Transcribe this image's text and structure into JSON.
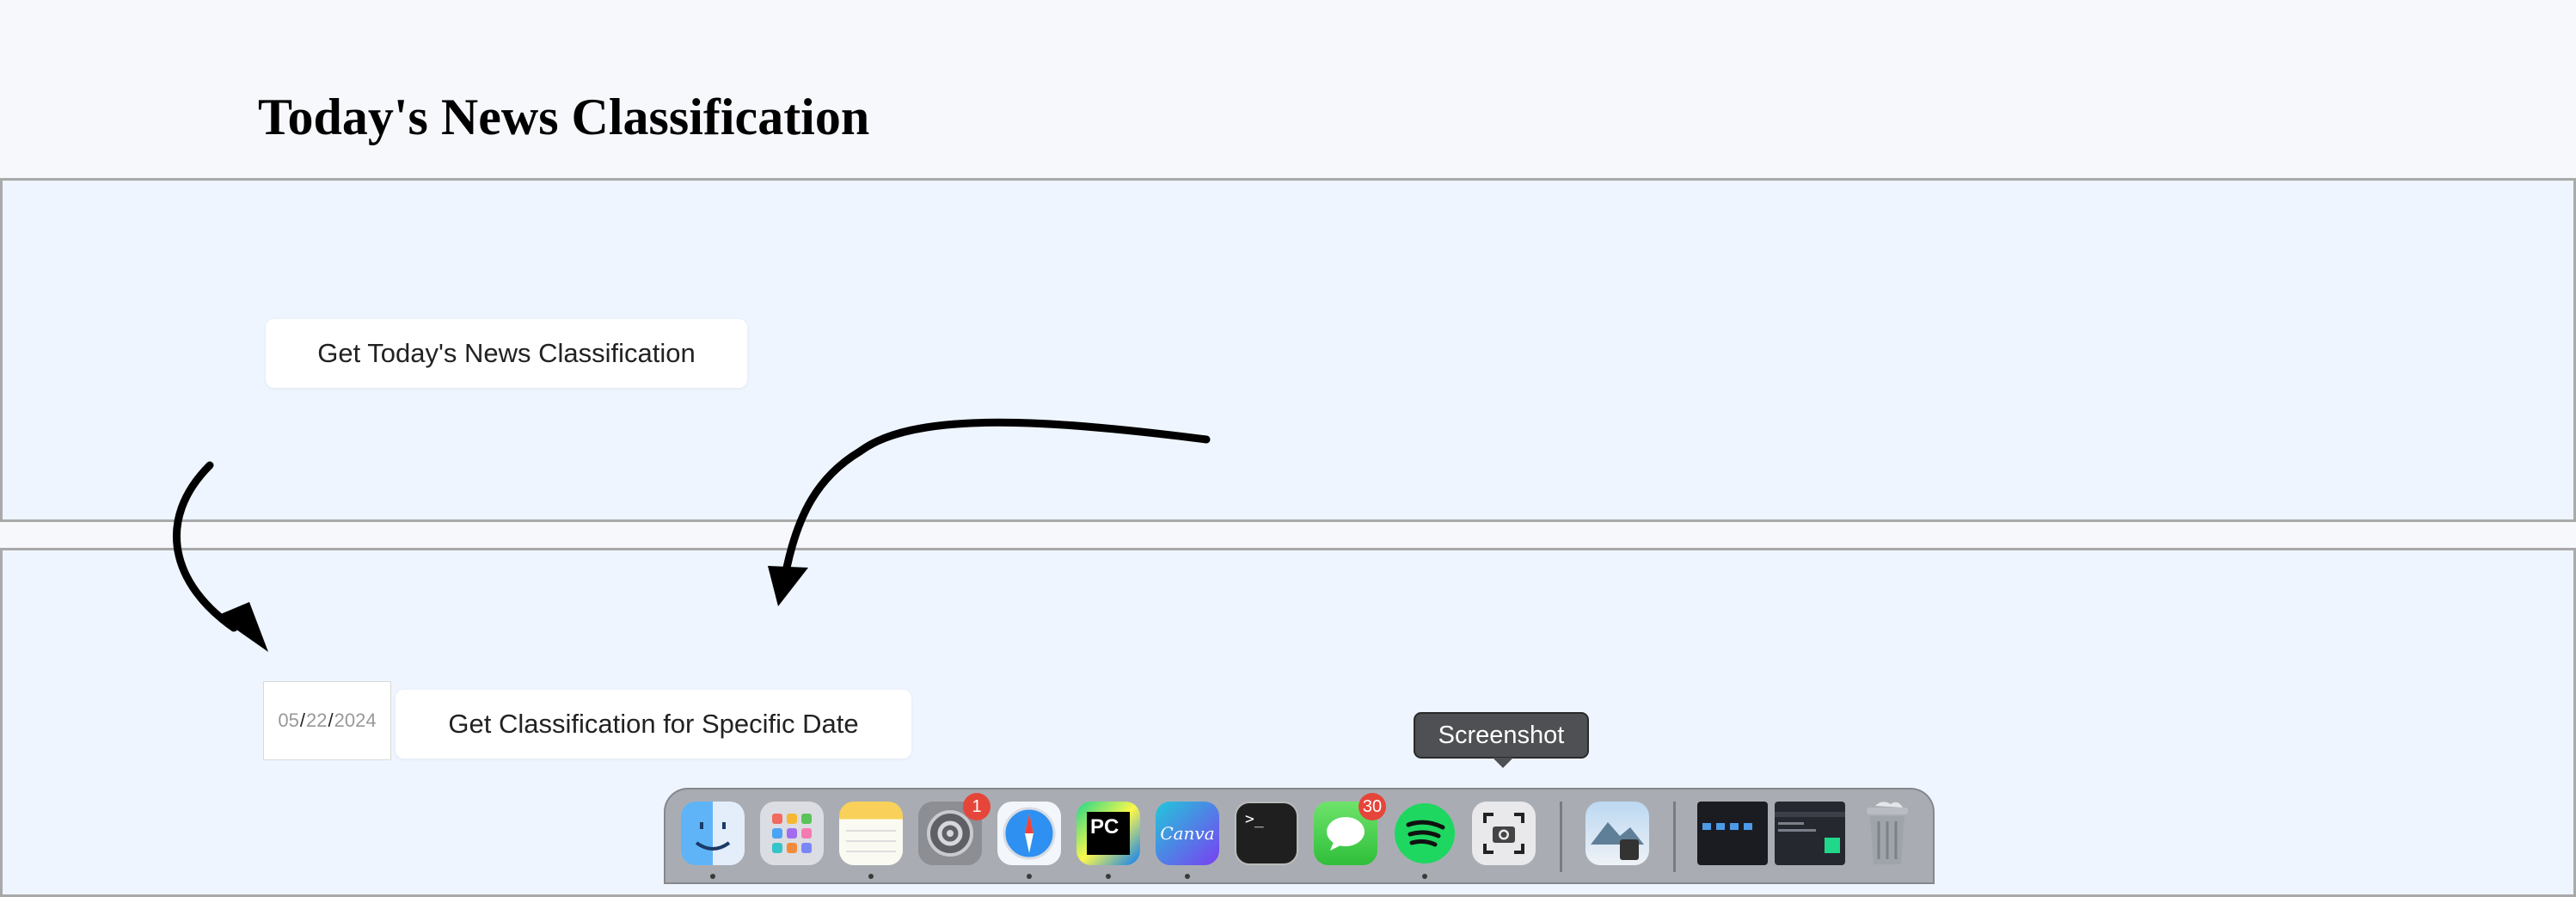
{
  "page": {
    "title": "Today's News Classification"
  },
  "section_today": {
    "button_label": "Get Today's News Classification"
  },
  "section_date": {
    "date_month": "05",
    "date_day": "22",
    "date_year": "2024",
    "date_separator": "/",
    "button_label": "Get Classification for Specific Date"
  },
  "dock": {
    "tooltip": "Screenshot",
    "items": [
      {
        "name": "Finder",
        "icon": "finder-icon",
        "running": true
      },
      {
        "name": "Launchpad",
        "icon": "launchpad-icon",
        "running": false
      },
      {
        "name": "Notes",
        "icon": "notes-icon",
        "running": true
      },
      {
        "name": "System Settings",
        "icon": "settings-icon",
        "running": false,
        "badge": "1"
      },
      {
        "name": "Safari",
        "icon": "safari-icon",
        "running": true
      },
      {
        "name": "PyCharm",
        "icon": "pycharm-icon",
        "running": true,
        "label": "PC"
      },
      {
        "name": "Canva",
        "icon": "canva-icon",
        "running": true,
        "label": "Canva"
      },
      {
        "name": "Terminal",
        "icon": "terminal-icon",
        "running": false,
        "label": ">_"
      },
      {
        "name": "Messages",
        "icon": "messages-icon",
        "running": false,
        "badge": "30"
      },
      {
        "name": "Spotify",
        "icon": "spotify-icon",
        "running": true
      },
      {
        "name": "Screenshot",
        "icon": "screenshot-icon",
        "running": false
      },
      {
        "name": "Preview",
        "icon": "preview-icon",
        "running": false
      },
      {
        "name": "Finder Window",
        "icon": "finder-window-thumbnail-icon",
        "running": false
      },
      {
        "name": "PyCharm Window",
        "icon": "pycharm-window-thumbnail-icon",
        "running": false
      },
      {
        "name": "Trash",
        "icon": "trash-icon",
        "running": false
      }
    ]
  }
}
